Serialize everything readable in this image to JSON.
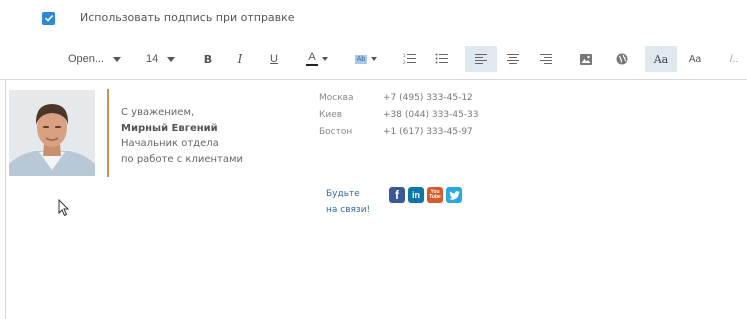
{
  "signature_toggle": {
    "checked": true,
    "label": "Использовать подпись при отправке"
  },
  "toolbar": {
    "font_family": "Open...",
    "font_size": "14",
    "bold": "B",
    "italic": "I",
    "underline": "U",
    "text_color_letter": "A",
    "text_color": "#222222",
    "highlight_label": "Ab",
    "highlight_color": "#a9c7e8",
    "style_a": "Aa",
    "style_b": "Aa",
    "more": "/..",
    "active_color": "#dfe7ef"
  },
  "signature": {
    "greeting": "С уважением,",
    "name": "Мирный Евгений",
    "title_line1": "Начальник отдела",
    "title_line2": "по работе с клиентами",
    "accent_color": "#cf8f52",
    "offices": [
      {
        "city": "Москва",
        "phone": "+7 (495) 333-45-12"
      },
      {
        "city": "Киев",
        "phone": "+38 (044) 333-45-33"
      },
      {
        "city": "Бостон",
        "phone": "+1 (617) 333-45-97"
      }
    ],
    "cta_line1": "Будьте",
    "cta_line2": "на связи!",
    "socials": [
      {
        "icon": "facebook-icon",
        "glyph": "f",
        "color": "#3b5998"
      },
      {
        "icon": "linkedin-icon",
        "glyph": "in",
        "color": "#0e76a8"
      },
      {
        "icon": "youtube-icon",
        "glyph": "You Tube",
        "color": "#d45b2a"
      },
      {
        "icon": "twitter-icon",
        "glyph": "t",
        "color": "#2aa9e0"
      }
    ]
  }
}
